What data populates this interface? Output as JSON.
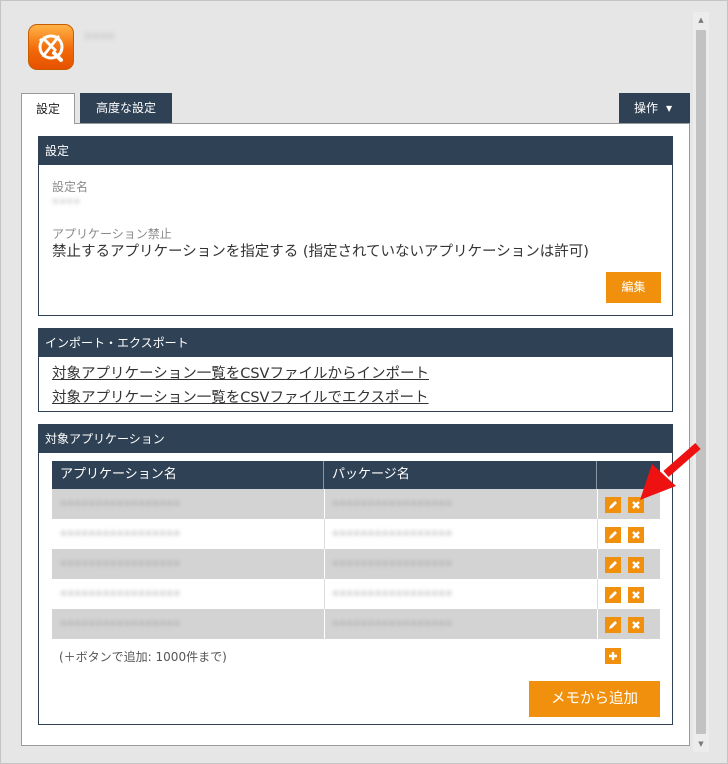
{
  "app": {
    "name": "••••",
    "icon": "app-shield-icon",
    "brand_color": "#f26a09"
  },
  "tabs": [
    {
      "label": "設定",
      "active": true
    },
    {
      "label": "高度な設定",
      "active": false
    }
  ],
  "operations_button": {
    "label": "操作",
    "icon": "caret-down-icon"
  },
  "settings_section": {
    "title": "設定",
    "name_label": "設定名",
    "name_value": "••••",
    "prohibit_label": "アプリケーション禁止",
    "prohibit_value": "禁止するアプリケーションを指定する (指定されていないアプリケーションは許可)",
    "edit_label": "編集"
  },
  "import_export_section": {
    "title": "インポート・エクスポート",
    "import_link": "対象アプリケーション一覧をCSVファイルからインポート",
    "export_link": "対象アプリケーション一覧をCSVファイルでエクスポート"
  },
  "apps_section": {
    "title": "対象アプリケーション",
    "columns": [
      "アプリケーション名",
      "パッケージ名",
      ""
    ],
    "rows": [
      {
        "name": "•••••••••••••••••",
        "package": "•••••••••••••••••"
      },
      {
        "name": "•••••••••••••••••",
        "package": "•••••••••••••••••"
      },
      {
        "name": "•••••••••••••••••",
        "package": "•••••••••••••••••"
      },
      {
        "name": "•••••••••••••••••",
        "package": "•••••••••••••••••"
      },
      {
        "name": "•••••••••••••••••",
        "package": "•••••••••••••••••"
      }
    ],
    "row_actions": {
      "edit_icon": "pencil-icon",
      "delete_icon": "close-icon"
    },
    "add_hint": "(＋ボタンで追加: 1000件まで)",
    "add_icon": "plus-icon",
    "add_from_memo_label": "メモから追加"
  },
  "annotation": {
    "arrow_color": "#ee1111"
  },
  "colors": {
    "header": "#2f4154",
    "accent": "#f0900c",
    "row_stripe": "#d3d3d3"
  }
}
